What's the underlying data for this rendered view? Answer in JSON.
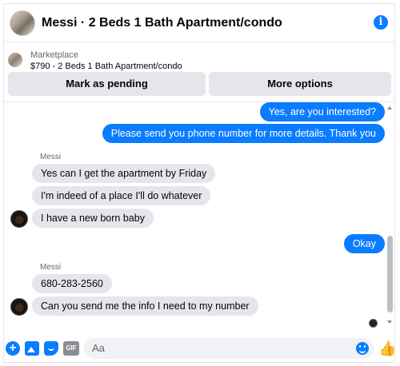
{
  "header": {
    "title": "Messi · 2 Beds 1 Bath Apartment/condo",
    "info_icon": "info-icon",
    "info_glyph": "i"
  },
  "marketplace": {
    "label": "Marketplace",
    "item": "$790 - 2 Beds 1 Bath Apartment/condo",
    "buttons": {
      "pending": "Mark as pending",
      "more": "More options"
    }
  },
  "messages": [
    {
      "from": "me",
      "text": "Yes, are you interested?"
    },
    {
      "from": "me",
      "text": "Please send you phone number for more details. Thank you"
    },
    {
      "from": "Messi",
      "text": "Yes can I get the apartment by Friday"
    },
    {
      "from": "Messi",
      "text": "I'm indeed of a place I'll do whatever"
    },
    {
      "from": "Messi",
      "text": "I have a new born baby"
    },
    {
      "from": "me",
      "text": "Okay"
    },
    {
      "from": "Messi",
      "text": "680-283-2560"
    },
    {
      "from": "Messi",
      "text": "Can you send me the info I need to my number"
    }
  ],
  "sender_labels": [
    "Messi",
    "Messi"
  ],
  "composer": {
    "placeholder": "Aa",
    "plus_glyph": "+",
    "gif_label": "GIF",
    "like_glyph": "👍",
    "icons": [
      "plus-icon",
      "photo-icon",
      "sticker-icon",
      "gif-icon",
      "emoji-icon",
      "like-icon"
    ]
  },
  "colors": {
    "accent": "#0a7cff",
    "incoming_bubble": "#e4e6eb",
    "button_bg": "#e4e6eb",
    "muted_text": "#65676b"
  }
}
